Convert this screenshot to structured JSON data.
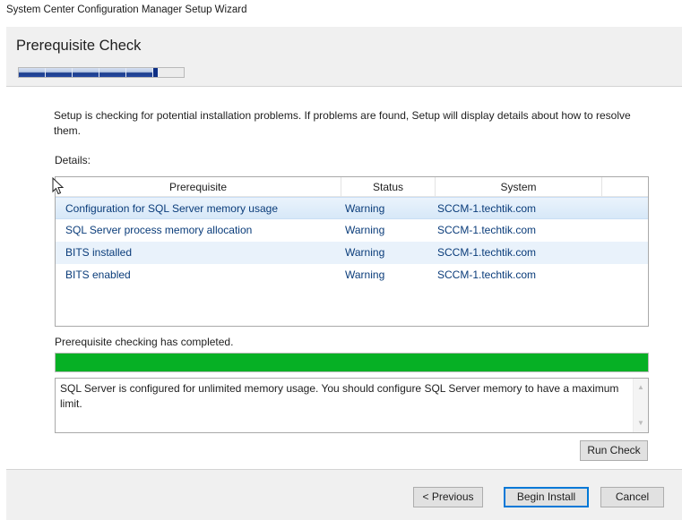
{
  "window": {
    "title": "System Center Configuration Manager Setup Wizard"
  },
  "header": {
    "page_title": "Prerequisite Check",
    "steps_completed": 5,
    "steps_total": 7
  },
  "content": {
    "intro": "Setup is checking for potential installation problems. If problems are found, Setup will display details about how to resolve them.",
    "details_label": "Details:",
    "table": {
      "columns": [
        "Prerequisite",
        "Status",
        "System"
      ],
      "rows": [
        {
          "prerequisite": "Configuration for SQL Server memory usage",
          "status": "Warning",
          "system": "SCCM-1.techtik.com"
        },
        {
          "prerequisite": "SQL Server process memory allocation",
          "status": "Warning",
          "system": "SCCM-1.techtik.com"
        },
        {
          "prerequisite": "BITS installed",
          "status": "Warning",
          "system": "SCCM-1.techtik.com"
        },
        {
          "prerequisite": "BITS enabled",
          "status": "Warning",
          "system": "SCCM-1.techtik.com"
        }
      ]
    },
    "status_text": "Prerequisite checking has completed.",
    "check_progress_percent": 100,
    "message": "SQL Server is configured for unlimited memory usage. You should configure SQL Server memory to have a maximum limit.",
    "run_check_label": "Run Check"
  },
  "footer": {
    "previous_label": "< Previous",
    "begin_install_label": "Begin Install",
    "cancel_label": "Cancel"
  },
  "colors": {
    "progress_green": "#06b025",
    "row_text": "#0a3c7a",
    "selection": "#d7e8f8",
    "accent": "#0078d7"
  },
  "icons": {
    "cursor": "mouse-pointer-icon",
    "scroll_up": "scroll-up-arrow-icon",
    "scroll_down": "scroll-down-arrow-icon"
  }
}
